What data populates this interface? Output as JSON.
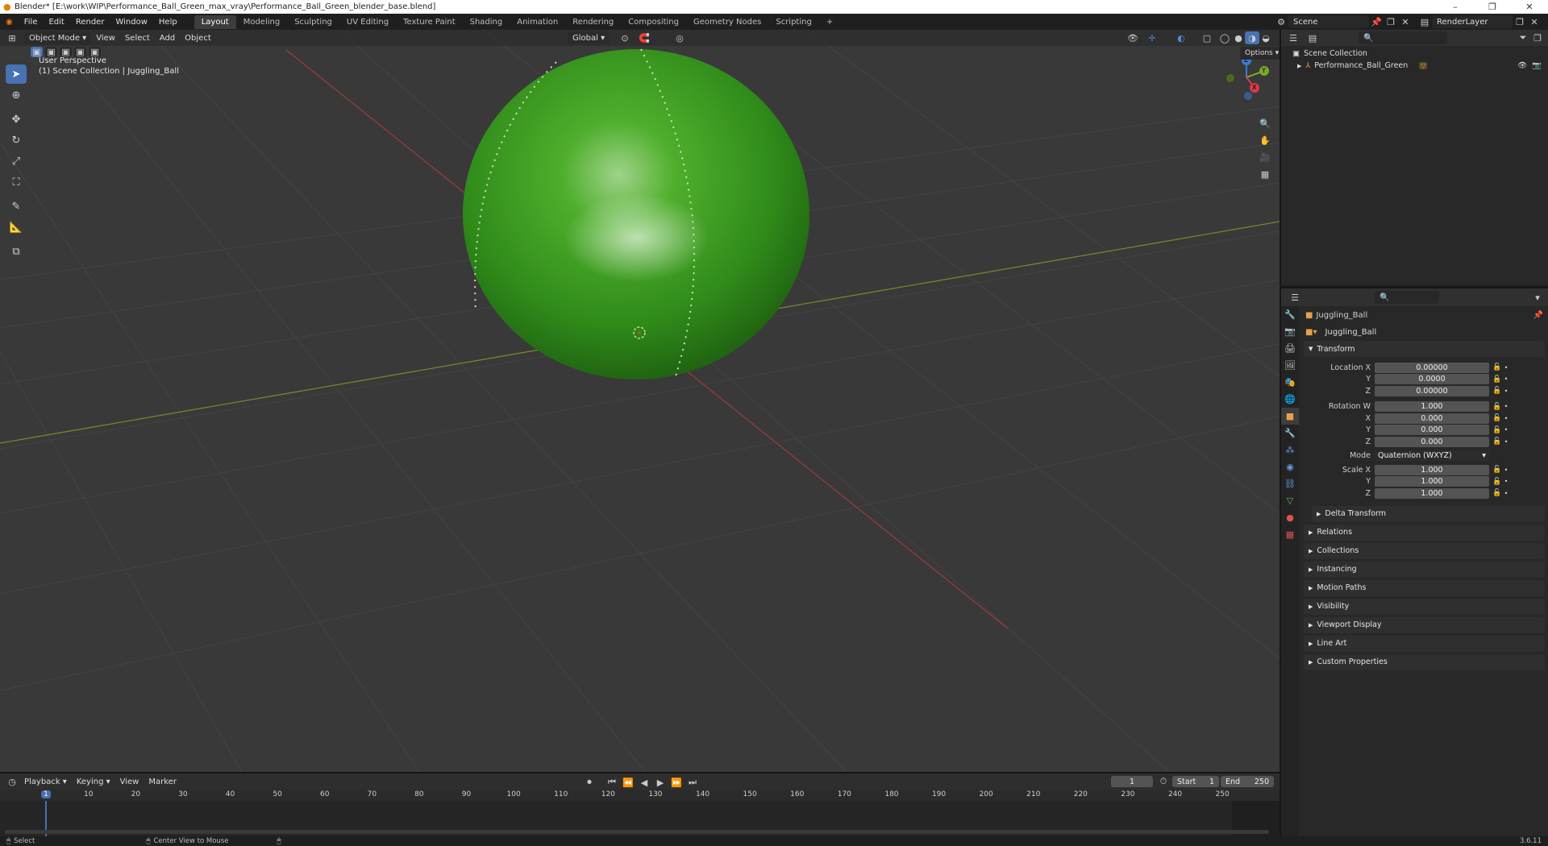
{
  "window": {
    "title": "Blender* [E:\\work\\WIP\\Performance_Ball_Green_max_vray\\Performance_Ball_Green_blender_base.blend]",
    "controls": [
      "–",
      "❐",
      "✕"
    ]
  },
  "menu": [
    "File",
    "Edit",
    "Render",
    "Window",
    "Help"
  ],
  "workspaces": [
    "Layout",
    "Modeling",
    "Sculpting",
    "UV Editing",
    "Texture Paint",
    "Shading",
    "Animation",
    "Rendering",
    "Compositing",
    "Geometry Nodes",
    "Scripting"
  ],
  "active_workspace": "Layout",
  "scene_name": "Scene",
  "render_layer": "RenderLayer",
  "viewport": {
    "mode": "Object Mode",
    "menus": [
      "View",
      "Select",
      "Add",
      "Object"
    ],
    "orientation": "Global",
    "options_label": "Options",
    "view_name": "User Perspective",
    "collection_info": "(1) Scene Collection | Juggling_Ball",
    "gizmo_axes": {
      "z": "Z",
      "y": "Y",
      "x": "X"
    },
    "ball_color": "#3f9a22"
  },
  "outliner": {
    "root": "Scene Collection",
    "items": [
      "Performance_Ball_Green"
    ]
  },
  "properties": {
    "object_name": "Juggling_Ball",
    "data_name": "Juggling_Ball",
    "transform_label": "Transform",
    "location": {
      "label": "Location X",
      "x": "0.00000",
      "y": "0.0000",
      "z": "0.00000",
      "y_label": "Y",
      "z_label": "Z"
    },
    "rotation": {
      "label": "Rotation W",
      "w": "1.000",
      "x": "0.000",
      "y": "0.000",
      "z": "0.000",
      "x_label": "X",
      "y_label": "Y",
      "z_label": "Z"
    },
    "mode": {
      "label": "Mode",
      "value": "Quaternion (WXYZ)"
    },
    "scale": {
      "label": "Scale X",
      "x": "1.000",
      "y": "1.000",
      "z": "1.000",
      "y_label": "Y",
      "z_label": "Z"
    },
    "delta_transform": "Delta Transform",
    "panels": [
      "Relations",
      "Collections",
      "Instancing",
      "Motion Paths",
      "Visibility",
      "Viewport Display",
      "Line Art",
      "Custom Properties"
    ]
  },
  "timeline": {
    "menus": [
      "Playback",
      "Keying",
      "View",
      "Marker"
    ],
    "current_frame": "1",
    "start_label": "Start",
    "start": "1",
    "end_label": "End",
    "end": "250",
    "ticks": [
      "1",
      "10",
      "20",
      "30",
      "40",
      "50",
      "60",
      "70",
      "80",
      "90",
      "100",
      "110",
      "120",
      "130",
      "140",
      "150",
      "160",
      "170",
      "180",
      "190",
      "200",
      "210",
      "220",
      "230",
      "240",
      "250"
    ]
  },
  "status": {
    "select": "Select",
    "center_view": "Center View to Mouse",
    "version": "3.6.11"
  }
}
